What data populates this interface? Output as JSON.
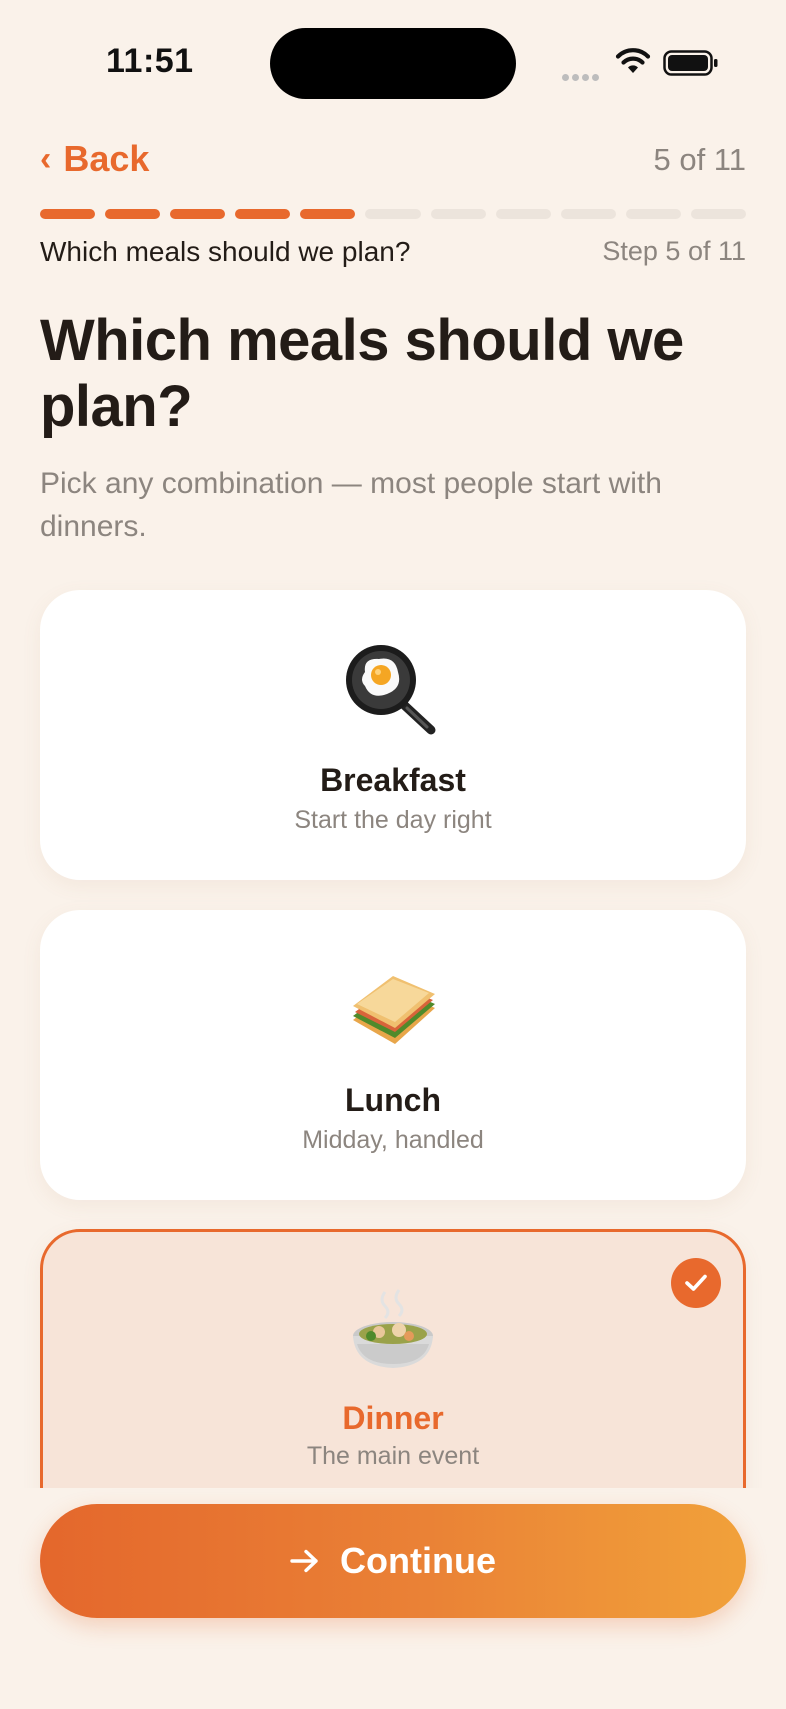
{
  "status_bar": {
    "time": "11:51"
  },
  "nav": {
    "back_label": "Back",
    "counter": "5 of 11"
  },
  "progress": {
    "current": 5,
    "total": 11
  },
  "step": {
    "label": "Which meals should we plan?",
    "count": "Step 5 of 11"
  },
  "heading": {
    "title": "Which meals should we plan?",
    "subtitle": "Pick any combination — most people start with dinners."
  },
  "options": [
    {
      "label": "Breakfast",
      "description": "Start the day right",
      "icon": "frying-pan-egg-icon",
      "selected": false
    },
    {
      "label": "Lunch",
      "description": "Midday, handled",
      "icon": "sandwich-icon",
      "selected": false
    },
    {
      "label": "Dinner",
      "description": "The main event",
      "icon": "stew-bowl-icon",
      "selected": true
    }
  ],
  "colors": {
    "accent": "#e8692d",
    "background": "#faf2ea",
    "selected_bg": "#f7e4d8"
  },
  "cta": {
    "label": "Continue",
    "icon": "arrow-right-icon"
  }
}
